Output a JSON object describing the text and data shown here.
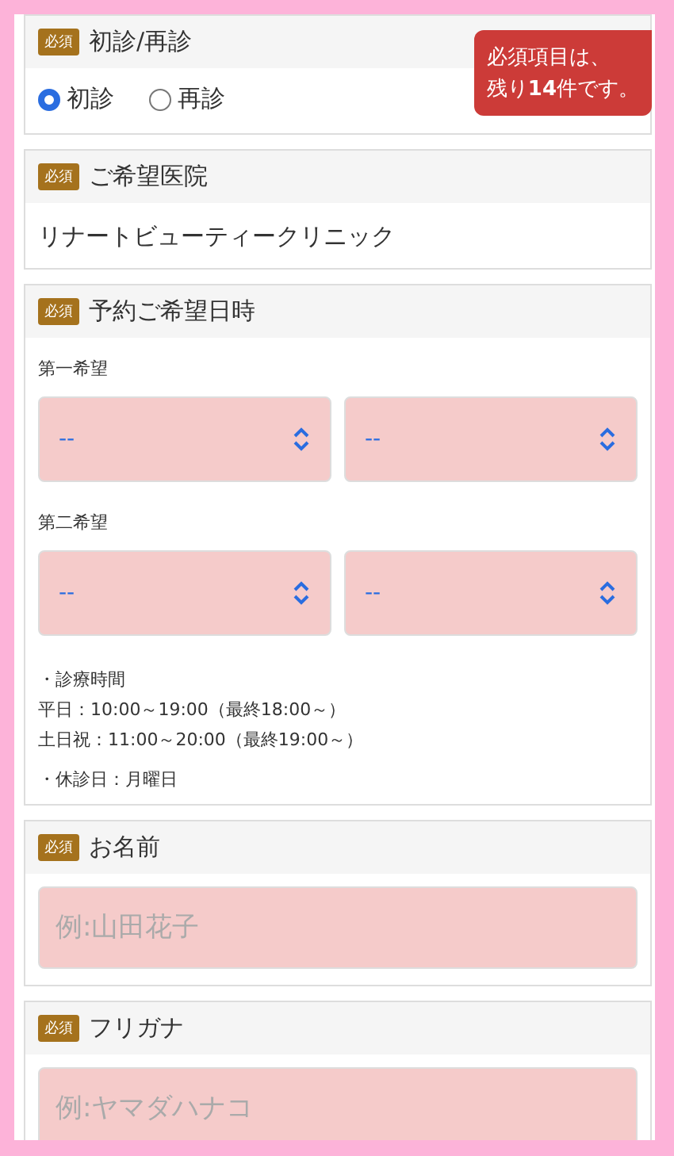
{
  "notice": {
    "lines": [
      "必須項目は、",
      "残り**14**件です。"
    ]
  },
  "sections": [
    {
      "kind": "radio",
      "badge": "必須",
      "title": "初診/再診",
      "options": [
        {
          "label": "初診",
          "selected": true
        },
        {
          "label": "再診",
          "selected": false
        }
      ]
    },
    {
      "kind": "static",
      "badge": "必須",
      "title": "ご希望医院",
      "value": "リナートビューティークリニック"
    },
    {
      "kind": "datetime",
      "badge": "必須",
      "title": "予約ご希望日時",
      "groups": [
        {
          "label": "第一希望",
          "selects": [
            "--",
            "--"
          ]
        },
        {
          "label": "第二希望",
          "selects": [
            "--",
            "--"
          ]
        }
      ],
      "notes": [
        "・診療時間",
        "平日：10:00～19:00（最終18:00～）",
        "土日祝：11:00～20:00（最終19:00～）",
        "・休診日：月曜日"
      ]
    },
    {
      "kind": "text",
      "badge": "必須",
      "title": "お名前",
      "placeholder": "例:山田花子"
    },
    {
      "kind": "text",
      "badge": "必須",
      "title": "フリガナ",
      "placeholder": "例:ヤマダハナコ"
    }
  ]
}
